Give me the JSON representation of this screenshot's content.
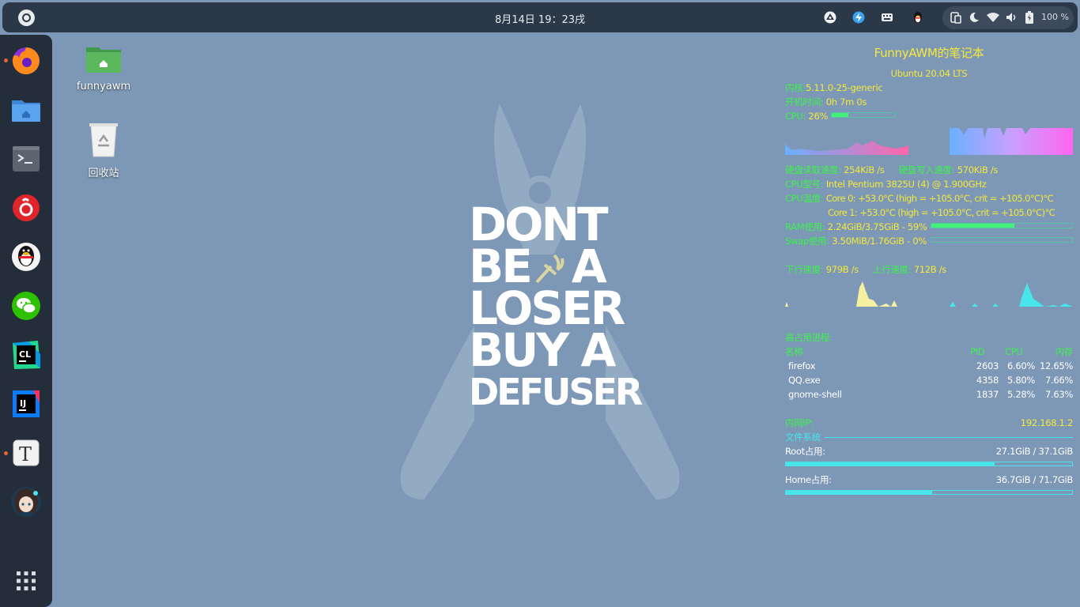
{
  "topbar": {
    "clock": "8月14日  19：23戌",
    "battery_pct": "100 %",
    "tray_icons": [
      "steam-icon",
      "lightning-icon",
      "keyboard-icon",
      "qq-penguin-icon"
    ],
    "quick_icons": [
      "screen-icon",
      "night-mode-icon",
      "wifi-icon",
      "volume-icon",
      "battery-icon"
    ]
  },
  "dock": {
    "apps": [
      "firefox",
      "files",
      "terminal",
      "netease-music",
      "qq",
      "wechat",
      "clion",
      "intellij-idea",
      "typora",
      "avatar-app"
    ],
    "running": [
      "firefox",
      "typora"
    ],
    "show_apps": "app-grid-icon"
  },
  "desktop": {
    "icons": [
      {
        "label": "funnyawm"
      },
      {
        "label": "回收站"
      }
    ]
  },
  "wallpaper": {
    "lines": [
      "DONT",
      "BE",
      "A",
      "LOSER",
      "BUY A",
      "DEFUSER"
    ]
  },
  "conky": {
    "title": "FunnyAWM的笔记本",
    "os": "Ubuntu 20.04 LTS",
    "kernel_label": "内核:",
    "kernel": "5.11.0-25-generic",
    "uptime_label": "开机时间: ",
    "uptime": "0h 7m 0s",
    "cpu_label": "CPU: ",
    "cpu_pct": "26%",
    "cpu_fraction": 0.26,
    "disk_read_label": "硬盘读取速度: ",
    "disk_read": "254KiB /s",
    "disk_write_label": "硬盘写入速度: ",
    "disk_write": "570KiB /s",
    "cpu_model_label": "CPU型号: ",
    "cpu_model": "Intel Pentium 3825U (4) @ 1.900GHz",
    "cpu_temp_label": "CPU温度: ",
    "core0": "Core 0:       +53.0°C  (high = +105.0°C, crit = +105.0°C)°C",
    "core1": "Core 1:       +53.0°C  (high = +105.0°C, crit = +105.0°C)°C",
    "ram_label": "RAM使用: ",
    "ram": "2.24GiB/3.75GiB - 59%",
    "ram_fraction": 0.59,
    "swap_label": "Swap使用: ",
    "swap": "3.50MiB/1.76GiB - 0%",
    "swap_fraction": 0.0,
    "down_label": "下行速度: ",
    "down": "979B   /s",
    "up_label": "上行速度: ",
    "up": "712B   /s",
    "proc_title": "高占用进程:",
    "proc_headers": {
      "name": "名称",
      "pid": "PID",
      "cpu": "CPU",
      "mem": "内存"
    },
    "processes": [
      {
        "name": "firefox",
        "pid": "2603",
        "cpu": "6.60%",
        "mem": "12.65%"
      },
      {
        "name": "QQ.exe",
        "pid": "4358",
        "cpu": "5.80%",
        "mem": "7.66%"
      },
      {
        "name": "gnome-shell",
        "pid": "1837",
        "cpu": "5.28%",
        "mem": "7.63%"
      }
    ],
    "ip_label": "内网IP:",
    "ip": "192.168.1.2",
    "fs_title": "文件系统",
    "root_label": "Root占用:",
    "root": "27.1GiB / 37.1GiB",
    "root_fraction": 0.73,
    "home_label": "Home占用:",
    "home": "36.7GiB / 71.7GiB",
    "home_fraction": 0.51
  }
}
